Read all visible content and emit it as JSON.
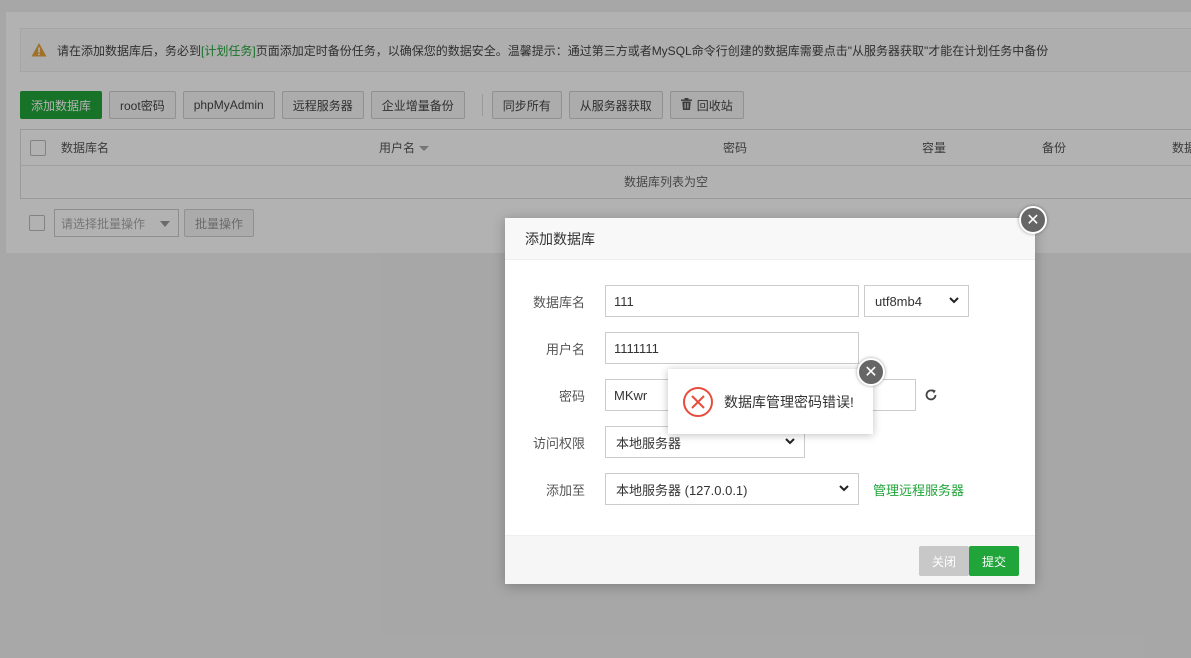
{
  "notice": {
    "text_before": "请在添加数据库后，务必到",
    "link": "[计划任务]",
    "text_after": "页面添加定时备份任务，以确保您的数据安全。温馨提示：通过第三方或者MySQL命令行创建的数据库需要点击\"从服务器获取\"才能在计划任务中备份",
    "icon": "warning-icon"
  },
  "toolbar": {
    "add_db": "添加数据库",
    "root_pwd": "root密码",
    "phpmyadmin": "phpMyAdmin",
    "remote_server": "远程服务器",
    "enterprise_backup": "企业增量备份",
    "sync_all": "同步所有",
    "fetch_from_server": "从服务器获取",
    "recycle_bin": "回收站"
  },
  "table": {
    "columns": [
      "数据库名",
      "用户名",
      "密码",
      "容量",
      "备份",
      "数据"
    ],
    "empty_text": "数据库列表为空"
  },
  "batch": {
    "select_placeholder": "请选择批量操作",
    "button": "批量操作"
  },
  "modal": {
    "title": "添加数据库",
    "fields": {
      "db_name_label": "数据库名",
      "db_name_value": "111",
      "charset_value": "utf8mb4",
      "username_label": "用户名",
      "username_value": "1111111",
      "password_label": "密码",
      "password_value": "MKwr",
      "access_label": "访问权限",
      "access_value": "本地服务器",
      "add_to_label": "添加至",
      "add_to_value": "本地服务器 (127.0.0.1)",
      "manage_remote_link": "管理远程服务器"
    },
    "footer": {
      "close": "关闭",
      "submit": "提交"
    }
  },
  "toast": {
    "message": "数据库管理密码错误!",
    "icon": "error-circle-icon"
  },
  "colors": {
    "brand_green": "#20a53a",
    "error_red": "#e74c3c"
  }
}
